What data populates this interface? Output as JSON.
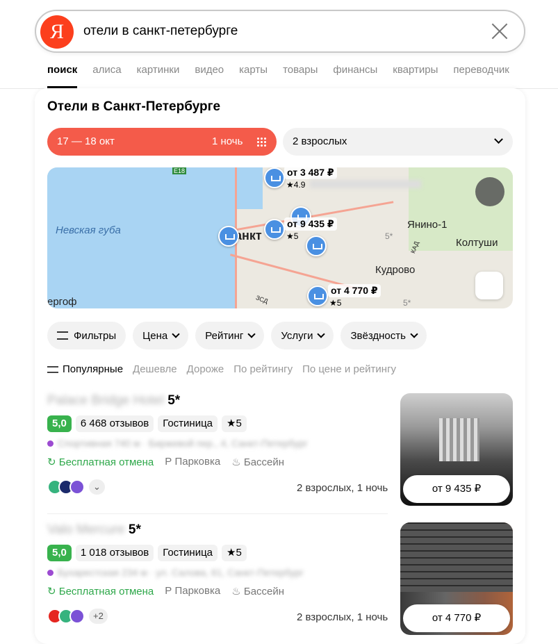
{
  "search": {
    "query": "отели в санкт-петербурге",
    "logo": "Я"
  },
  "tabs": [
    "поиск",
    "алиса",
    "картинки",
    "видео",
    "карты",
    "товары",
    "финансы",
    "квартиры",
    "переводчик"
  ],
  "card": {
    "title": "Отели в Санкт-Петербурге",
    "dates": "17 — 18 окт",
    "nights": "1 ночь",
    "guests": "2 взрослых"
  },
  "map": {
    "labels": {
      "gulf": "Невская губа",
      "yanino": "Янино-1",
      "koltushi": "Колтуши",
      "kudrovo": "Кудрово",
      "city": "анкт",
      "peterhof": "ергоф",
      "e18": "E18",
      "zsd": "ЗСД",
      "kad": "КАД"
    },
    "pins": [
      {
        "price": "от 3 487 ₽",
        "rating": "★4.9"
      },
      {
        "price": "от 9 435 ₽",
        "rating": "★5"
      },
      {
        "price": "от 4 770 ₽",
        "rating": "★5"
      }
    ],
    "star_marks": [
      "5*",
      "5*"
    ]
  },
  "filters": [
    "Фильтры",
    "Цена",
    "Рейтинг",
    "Услуги",
    "Звёздность"
  ],
  "sorts": [
    "Популярные",
    "Дешевле",
    "Дороже",
    "По рейтингу",
    "По цене и рейтингу"
  ],
  "hotels": [
    {
      "name": "Palace Bridge Hotel",
      "stars": "5*",
      "rating": "5,0",
      "reviews": "6 468 отзывов",
      "type": "Гостиница",
      "star_chip": "★5",
      "address": "Спортивная 740 м · Биржевой пер., 4, Санкт-Петербург",
      "amenities": [
        "Бесплатная отмена",
        "Парковка",
        "Бассейн"
      ],
      "providers_more": "",
      "guests": "2 взрослых, 1 ночь",
      "price": "от 9 435 ₽"
    },
    {
      "name": "Valo Mercure",
      "stars": "5*",
      "rating": "5,0",
      "reviews": "1 018 отзывов",
      "type": "Гостиница",
      "star_chip": "★5",
      "address": "Бухарестская 234 м · ул. Салова, 61, Санкт-Петербург",
      "amenities": [
        "Бесплатная отмена",
        "Парковка",
        "Бассейн"
      ],
      "providers_more": "+2",
      "guests": "2 взрослых, 1 ночь",
      "price": "от 4 770 ₽"
    }
  ],
  "colors": {
    "accent": "#f45b4a",
    "rating": "#38b24d",
    "free": "#2fa84b",
    "pin": "#4a90e2"
  }
}
